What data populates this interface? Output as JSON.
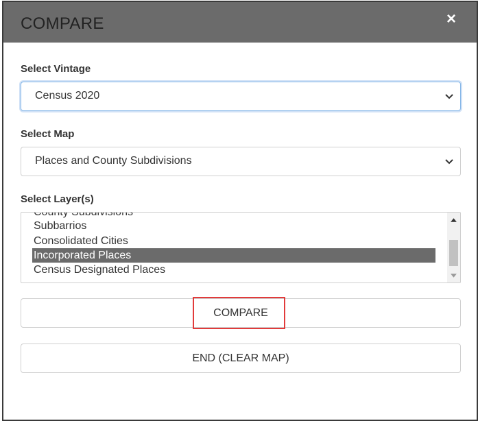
{
  "dialog": {
    "title": "COMPARE",
    "close_glyph": "×",
    "close_icon": "close-icon"
  },
  "vintage": {
    "label": "Select Vintage",
    "value": "Census 2020"
  },
  "map": {
    "label": "Select Map",
    "value": "Places and County Subdivisions"
  },
  "layers": {
    "label": "Select Layer(s)",
    "items": [
      {
        "label": "County Subdivisions"
      },
      {
        "label": "Subbarrios"
      },
      {
        "label": "Consolidated Cities"
      },
      {
        "label": "Incorporated Places",
        "selected": true
      },
      {
        "label": "Census Designated Places"
      }
    ]
  },
  "buttons": {
    "compare_label": "COMPARE",
    "end_label": "END (CLEAR MAP)"
  },
  "colors": {
    "header_bg": "#6b6b6b",
    "selected_bg": "#6b6b6b",
    "highlight": "#e23b3b",
    "focus": "#86b7e8"
  }
}
